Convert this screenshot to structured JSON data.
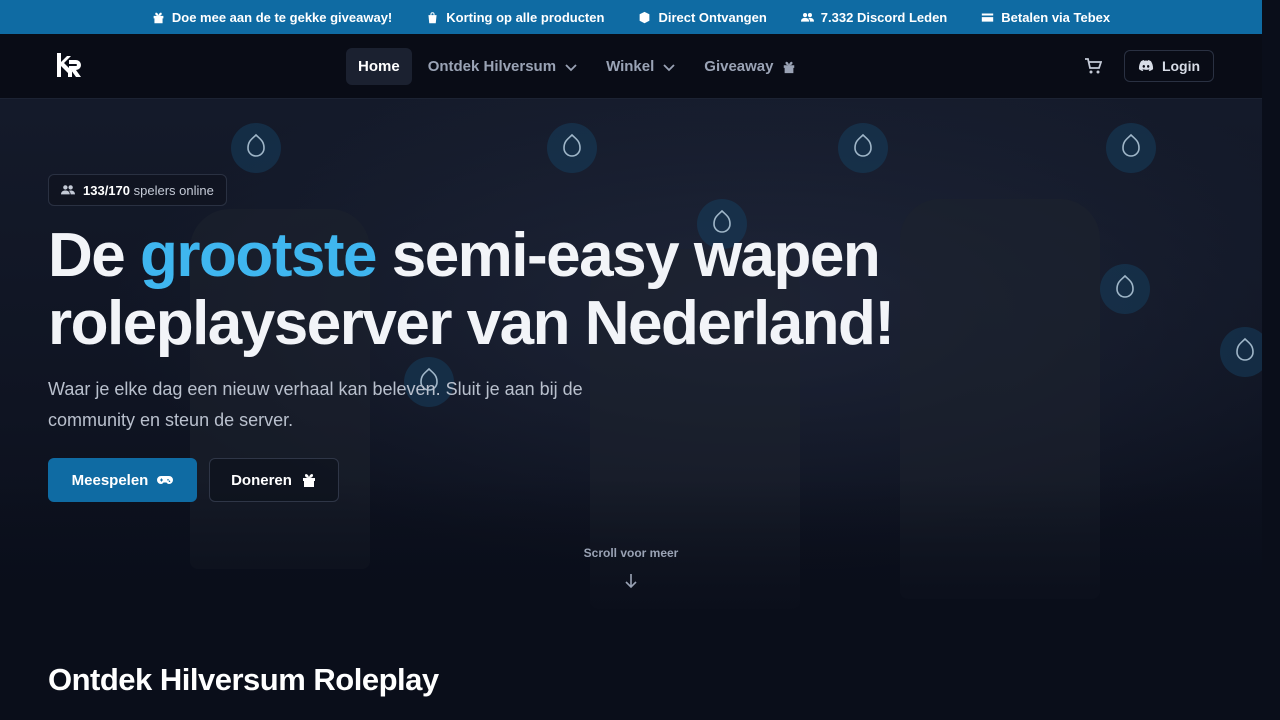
{
  "topbar": {
    "items": [
      {
        "icon": "gift-icon",
        "label": "Doe mee aan de te gekke giveaway!"
      },
      {
        "icon": "bag-icon",
        "label": "Korting op alle producten"
      },
      {
        "icon": "box-icon",
        "label": "Direct Ontvangen"
      },
      {
        "icon": "users-icon",
        "label": "7.332 Discord Leden"
      },
      {
        "icon": "card-icon",
        "label": "Betalen via Tebex"
      }
    ],
    "background": "#0f6ba3"
  },
  "nav": {
    "logo": "HR logo",
    "links": [
      {
        "label": "Home",
        "active": true
      },
      {
        "label": "Ontdek Hilversum",
        "dropdown": true
      },
      {
        "label": "Winkel",
        "dropdown": true
      },
      {
        "label": "Giveaway",
        "icon": "gift-icon"
      }
    ],
    "cart_icon": "cart-icon",
    "login_label": "Login",
    "login_icon": "discord-icon"
  },
  "hero": {
    "players_count": "133/170",
    "players_suffix": "spelers online",
    "headline_pre": "De ",
    "headline_accent": "grootste",
    "headline_rest1": " semi-easy wapen",
    "headline_rest2": "roleplayserver van Nederland!",
    "subtitle": "Waar je elke dag een nieuw verhaal kan beleven. Sluit je aan bij de community en steun de server.",
    "primary_button": "Meespelen",
    "primary_icon": "gamepad-icon",
    "secondary_button": "Doneren",
    "secondary_icon": "gift-icon",
    "scroll_hint": "Scroll voor meer",
    "accent_color": "#3fb6ef"
  },
  "section": {
    "title": "Ontdek Hilversum Roleplay"
  }
}
